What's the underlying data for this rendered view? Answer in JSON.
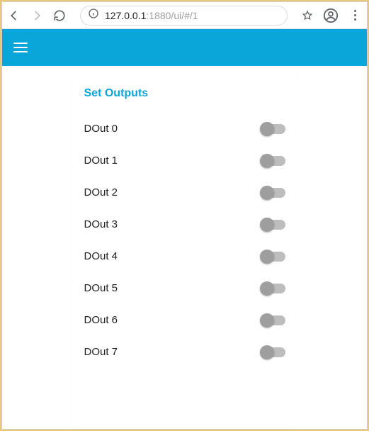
{
  "browser": {
    "url_host": "127.0.0.1",
    "url_rest": ":1880/ui/#/1"
  },
  "header": {
    "accent": "#0ba6d9"
  },
  "panel": {
    "title": "Set Outputs",
    "rows": [
      {
        "label": "DOut 0",
        "on": false
      },
      {
        "label": "DOut 1",
        "on": false
      },
      {
        "label": "DOut 2",
        "on": false
      },
      {
        "label": "DOut 3",
        "on": false
      },
      {
        "label": "DOut 4",
        "on": false
      },
      {
        "label": "DOut 5",
        "on": false
      },
      {
        "label": "DOut 6",
        "on": false
      },
      {
        "label": "DOut 7",
        "on": false
      }
    ]
  }
}
